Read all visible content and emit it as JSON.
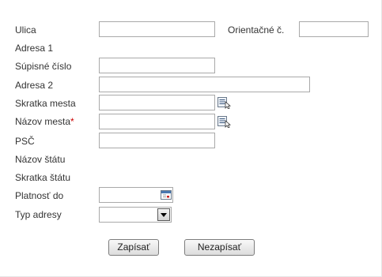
{
  "form": {
    "street": {
      "label": "Ulica",
      "value": ""
    },
    "orientation_number": {
      "label": "Orientačné č.",
      "value": ""
    },
    "address1": {
      "label": "Adresa 1"
    },
    "registry_number": {
      "label": "Súpisné číslo",
      "value": ""
    },
    "address2": {
      "label": "Adresa 2",
      "value": ""
    },
    "city_abbrev": {
      "label": "Skratka mesta",
      "value": "",
      "icon": "lookup-list-icon"
    },
    "city_name": {
      "label": "Názov mesta",
      "required_marker": "*",
      "value": "",
      "icon": "lookup-list-icon"
    },
    "postal_code": {
      "label": "PSČ",
      "value": ""
    },
    "state_name": {
      "label": "Názov štátu"
    },
    "state_abbrev": {
      "label": "Skratka štátu"
    },
    "valid_until": {
      "label": "Platnosť do",
      "value": "",
      "icon": "calendar-icon"
    },
    "address_type": {
      "label": "Typ adresy",
      "selected": ""
    }
  },
  "actions": {
    "save_label": "Zapísať",
    "cancel_label": "Nezapísať"
  },
  "colors": {
    "required": "#cc0000",
    "text": "#333333",
    "border": "#a9a9a9"
  }
}
